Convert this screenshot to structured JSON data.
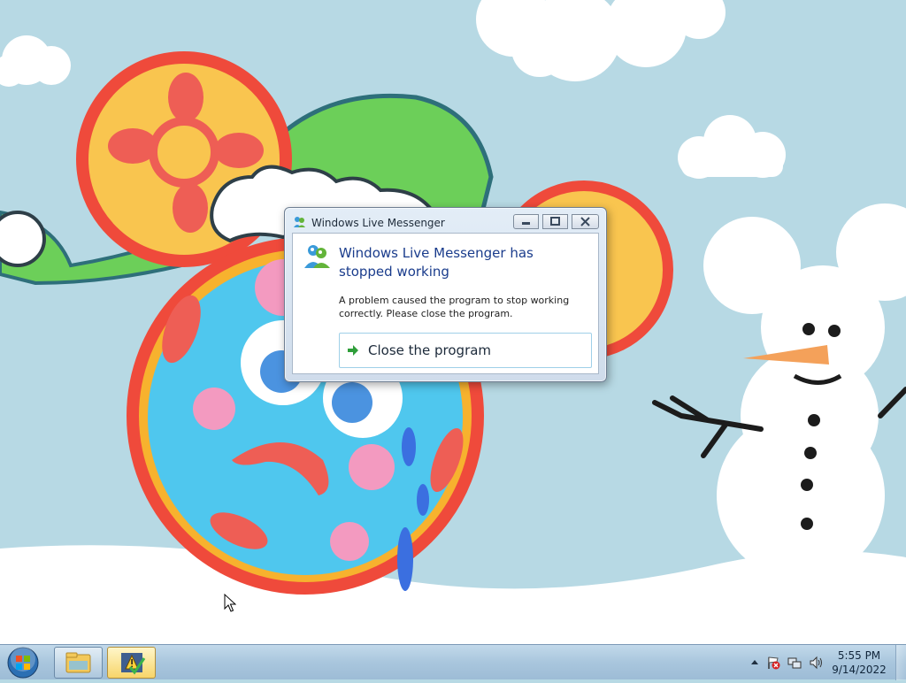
{
  "dialog": {
    "title": "Windows Live Messenger",
    "headline": "Windows Live Messenger has stopped working",
    "description": "A problem caused the program to stop working correctly. Please close the program.",
    "action_label": "Close the program",
    "icons": {
      "title": "messenger-icon",
      "app": "messenger-buddies-icon",
      "action": "green-arrow-icon"
    }
  },
  "taskbar": {
    "start_icon": "windows-logo-icon",
    "buttons": [
      {
        "icon": "file-explorer-icon"
      },
      {
        "icon": "problem-reporting-icon",
        "active": true
      }
    ],
    "tray": {
      "icons": [
        "show-hidden-icons",
        "action-center-warning-icon",
        "network-icon",
        "volume-icon"
      ],
      "time": "5:55 PM",
      "date": "9/14/2022"
    }
  },
  "colors": {
    "headline": "#1a3c8c",
    "desktop_sky": "#b7d9e4",
    "taskbar": "#a9c6dd"
  }
}
